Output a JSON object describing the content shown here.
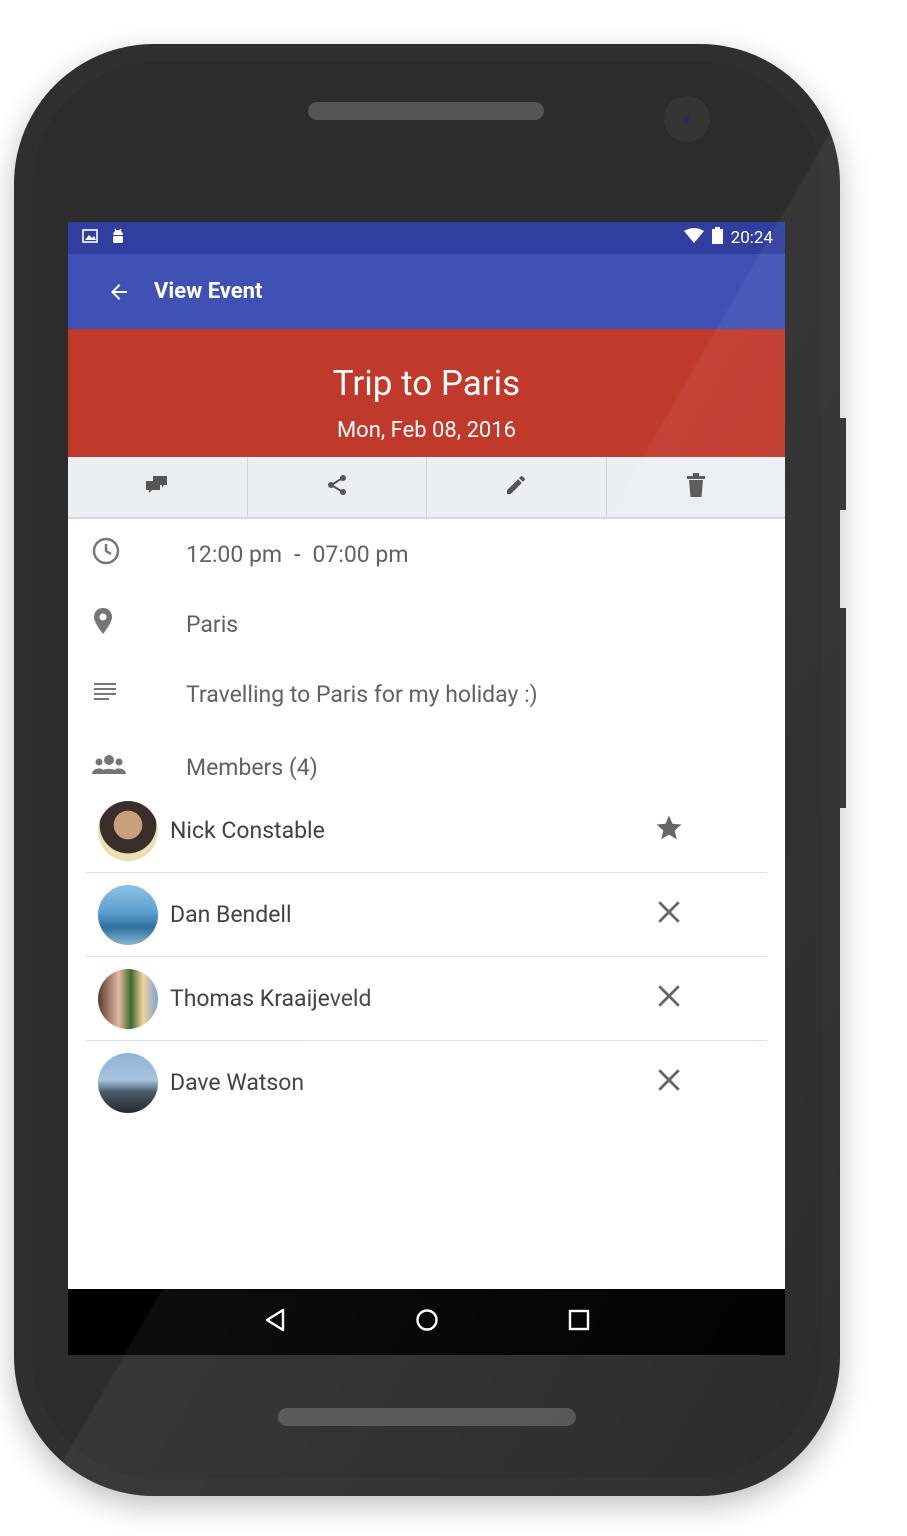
{
  "status_bar": {
    "time": "20:24",
    "left_icons": [
      "image-icon",
      "android-icon"
    ],
    "right_icons": [
      "wifi-icon",
      "battery-icon"
    ]
  },
  "app_bar": {
    "title": "View Event"
  },
  "event": {
    "title": "Trip to Paris",
    "date": "Mon, Feb 08, 2016"
  },
  "actions": [
    {
      "name": "chat-icon"
    },
    {
      "name": "share-icon"
    },
    {
      "name": "edit-icon"
    },
    {
      "name": "delete-icon"
    }
  ],
  "details": {
    "time_start": "12:00 pm",
    "time_sep": "-",
    "time_end": "07:00 pm",
    "location": "Paris",
    "description": "Travelling to Paris for my holiday :)",
    "members_label": "Members (4)"
  },
  "members": [
    {
      "name": "Nick Constable",
      "action": "star-icon"
    },
    {
      "name": "Dan Bendell",
      "action": "remove-icon"
    },
    {
      "name": "Thomas Kraaijeveld",
      "action": "remove-icon"
    },
    {
      "name": "Dave Watson",
      "action": "remove-icon"
    }
  ],
  "colors": {
    "status_bar": "#303f9f",
    "app_bar": "#3f51b5",
    "header": "#c0392b",
    "actions_bg": "#eceff1"
  }
}
